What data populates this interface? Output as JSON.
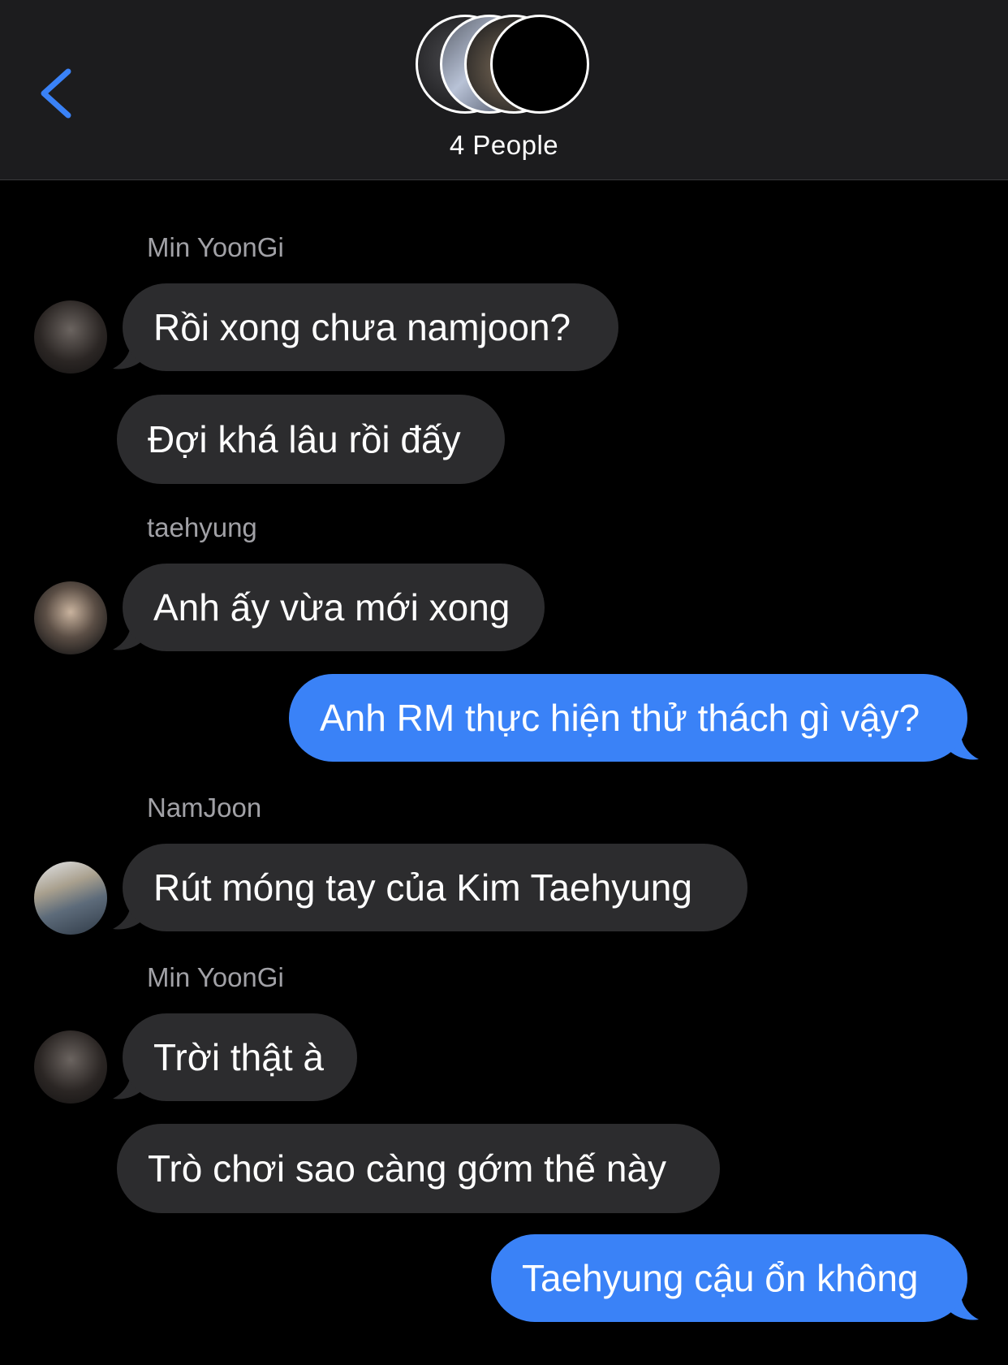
{
  "colors": {
    "header_bg": "#1c1c1e",
    "incoming_bubble": "#2c2c2e",
    "outgoing_bubble": "#3a82f7",
    "accent": "#3a82f7",
    "sender_name": "#a1a1a6"
  },
  "header": {
    "back_icon": "chevron-left-icon",
    "title": "4 People"
  },
  "messages": [
    {
      "sender": "Min YoonGi",
      "text": "Rồi xong chưa namjoon?",
      "direction": "incoming"
    },
    {
      "sender": "Min YoonGi",
      "text": "Đợi khá lâu rồi đấy",
      "direction": "incoming"
    },
    {
      "sender": "taehyung",
      "text": "Anh ấy vừa mới xong",
      "direction": "incoming"
    },
    {
      "sender": "",
      "text": "Anh RM thực hiện thử thách gì vậy?",
      "direction": "outgoing"
    },
    {
      "sender": "NamJoon",
      "text": "Rút móng tay của Kim Taehyung",
      "direction": "incoming"
    },
    {
      "sender": "Min YoonGi",
      "text": "Trời thật à",
      "direction": "incoming"
    },
    {
      "sender": "Min YoonGi",
      "text": "Trò chơi sao càng gớm thế này",
      "direction": "incoming"
    },
    {
      "sender": "",
      "text": "Taehyung cậu ổn không",
      "direction": "outgoing"
    }
  ]
}
